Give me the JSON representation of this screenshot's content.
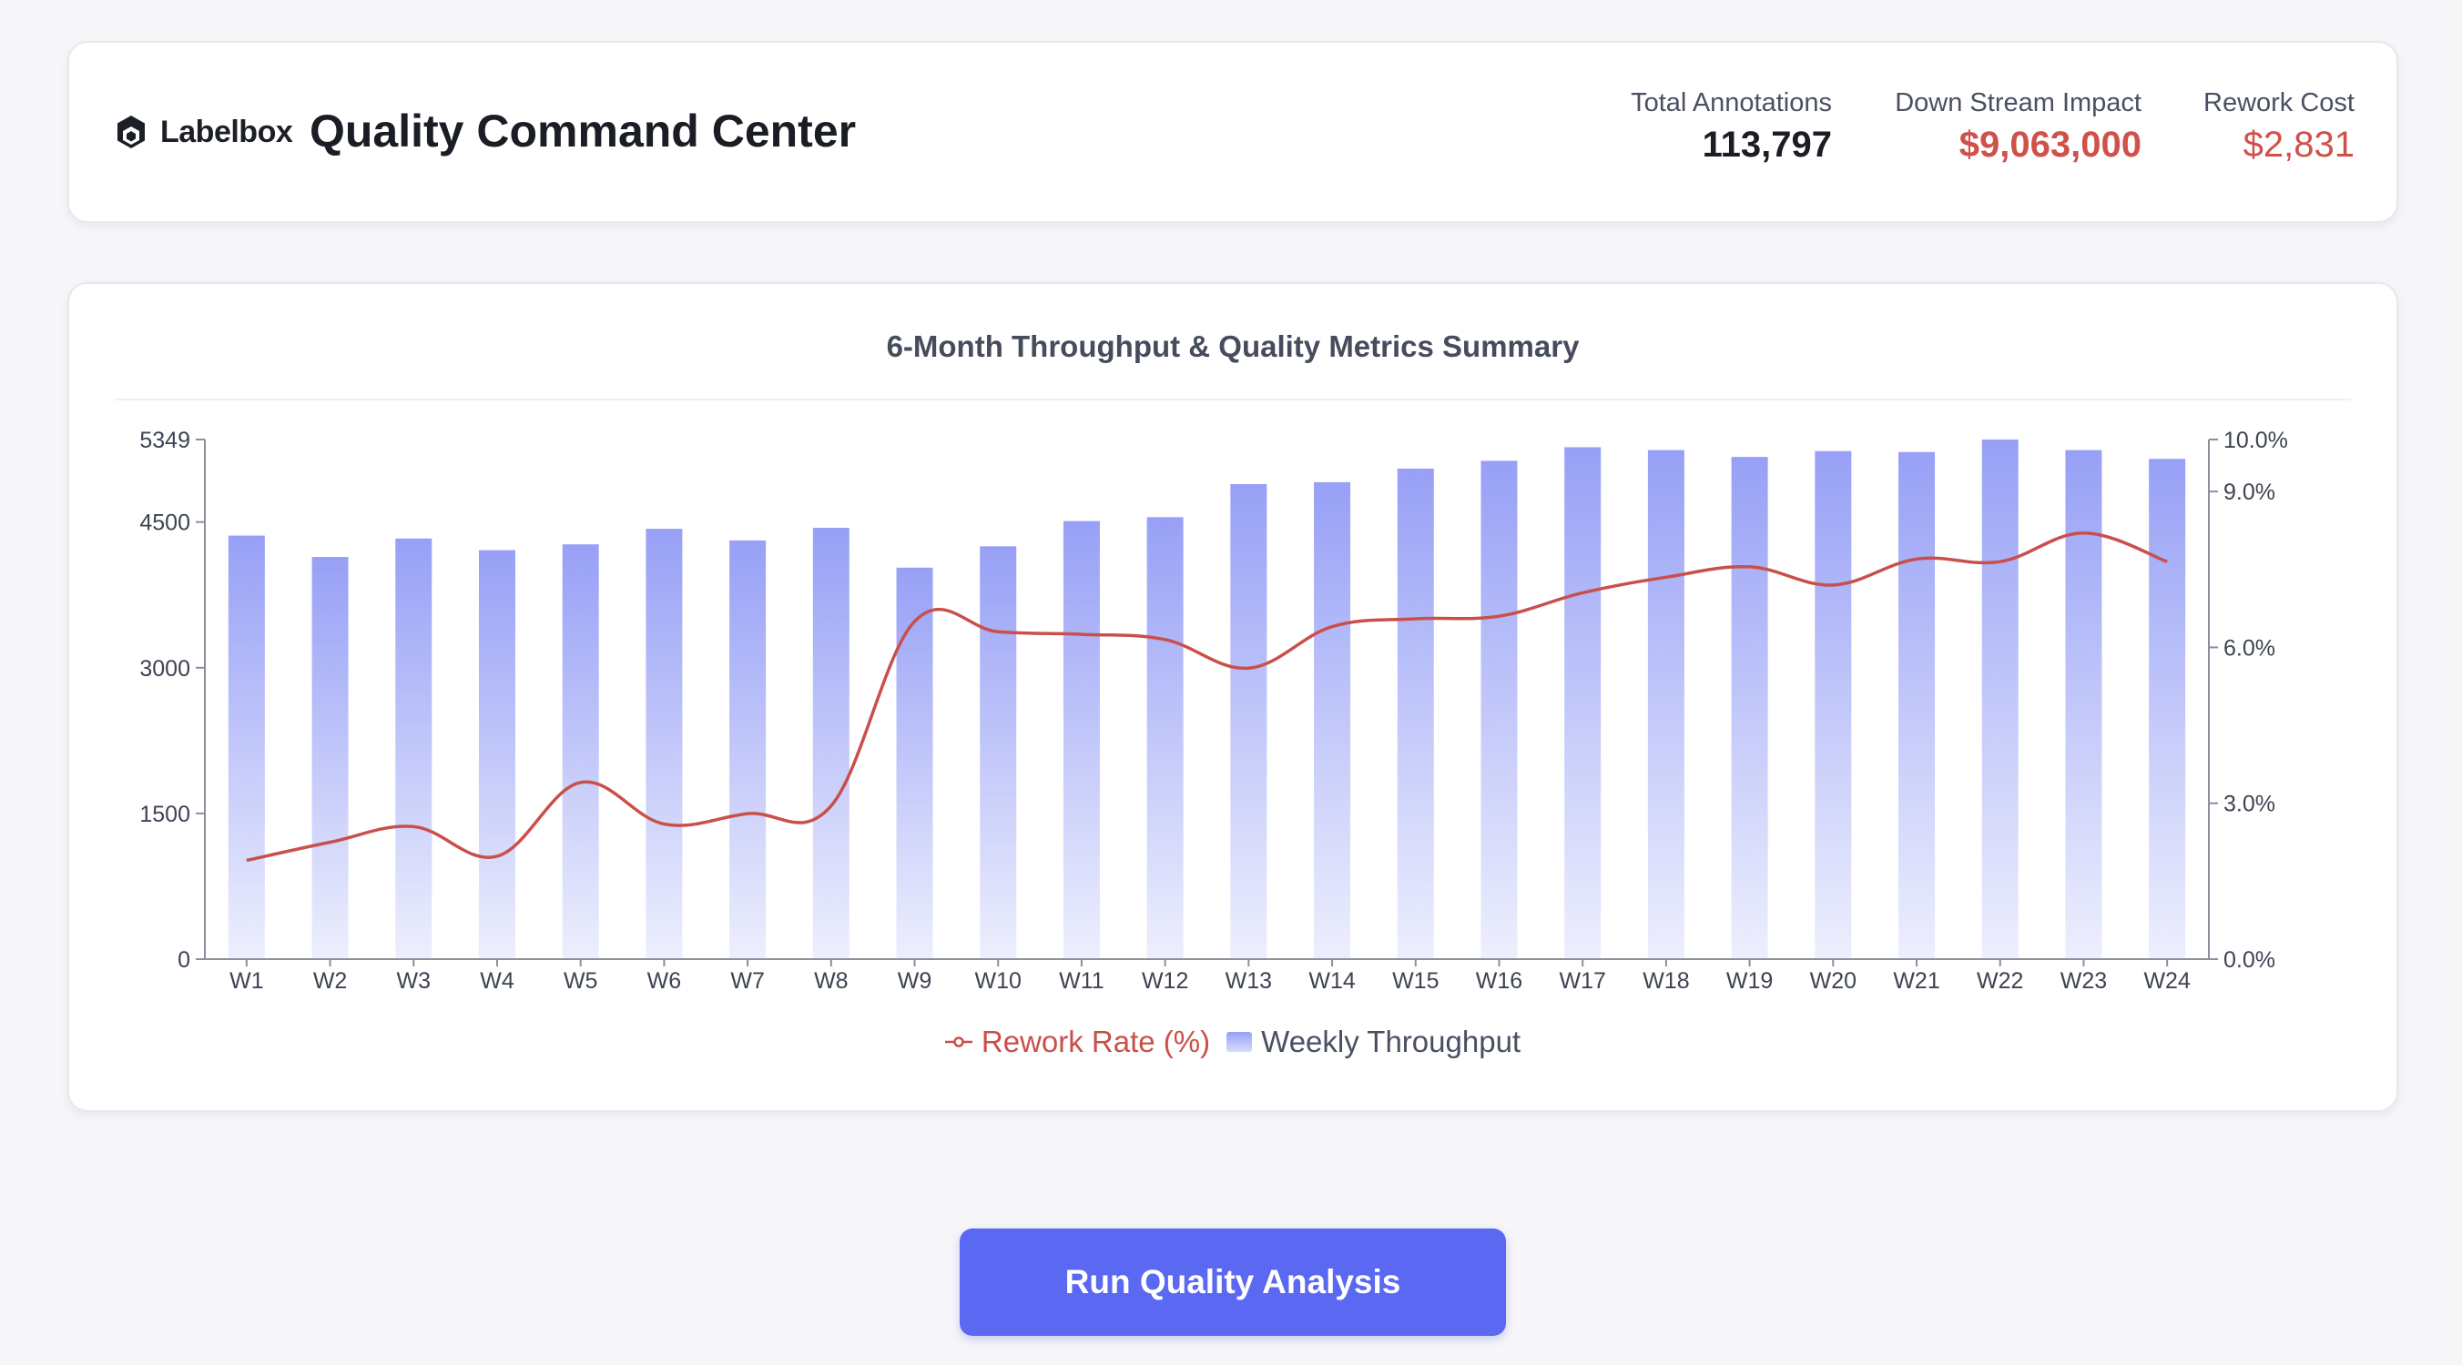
{
  "header": {
    "logo_text": "Labelbox",
    "title": "Quality Command Center",
    "stats": {
      "total_annotations": {
        "label": "Total Annotations",
        "value": "113,797",
        "color": "#1a1d24"
      },
      "downstream_impact": {
        "label": "Down Stream Impact",
        "value": "$9,063,000",
        "color": "#d0504a"
      },
      "rework_cost": {
        "label": "Rework Cost",
        "value": "$2,831",
        "color": "#d0504a"
      }
    }
  },
  "chart_data": {
    "type": "bar",
    "title": "6-Month Throughput & Quality Metrics Summary",
    "categories": [
      "W1",
      "W2",
      "W3",
      "W4",
      "W5",
      "W6",
      "W7",
      "W8",
      "W9",
      "W10",
      "W11",
      "W12",
      "W13",
      "W14",
      "W15",
      "W16",
      "W17",
      "W18",
      "W19",
      "W20",
      "W21",
      "W22",
      "W23",
      "W24"
    ],
    "series": [
      {
        "name": "Weekly Throughput",
        "type": "bar",
        "axis": "left",
        "color": "#9aa2f7",
        "values": [
          4360,
          4140,
          4330,
          4210,
          4270,
          4430,
          4310,
          4440,
          4030,
          4250,
          4510,
          4550,
          4890,
          4910,
          5050,
          5130,
          5270,
          5240,
          5170,
          5230,
          5220,
          5349,
          5240,
          5150
        ]
      },
      {
        "name": "Rework Rate (%)",
        "type": "line",
        "axis": "right",
        "color": "#c9504a",
        "values": [
          1.9,
          2.25,
          2.55,
          1.98,
          3.4,
          2.6,
          2.8,
          2.95,
          6.5,
          6.3,
          6.25,
          6.15,
          5.6,
          6.4,
          6.55,
          6.6,
          7.05,
          7.35,
          7.55,
          7.2,
          7.7,
          7.65,
          8.2,
          7.65
        ]
      }
    ],
    "y_left": {
      "ticks": [
        0,
        1500,
        3000,
        4500,
        5349
      ],
      "range": [
        0,
        5349
      ]
    },
    "y_right": {
      "ticks": [
        0.0,
        3.0,
        6.0,
        9.0,
        10.0
      ],
      "range": [
        0,
        10
      ],
      "tick_suffix": "%"
    },
    "legend": {
      "placement": "bottom",
      "items": [
        "Rework Rate (%)",
        "Weekly Throughput"
      ]
    },
    "grid": false
  },
  "actions": {
    "run_label": "Run Quality Analysis",
    "run_color": "#5a68f2"
  }
}
